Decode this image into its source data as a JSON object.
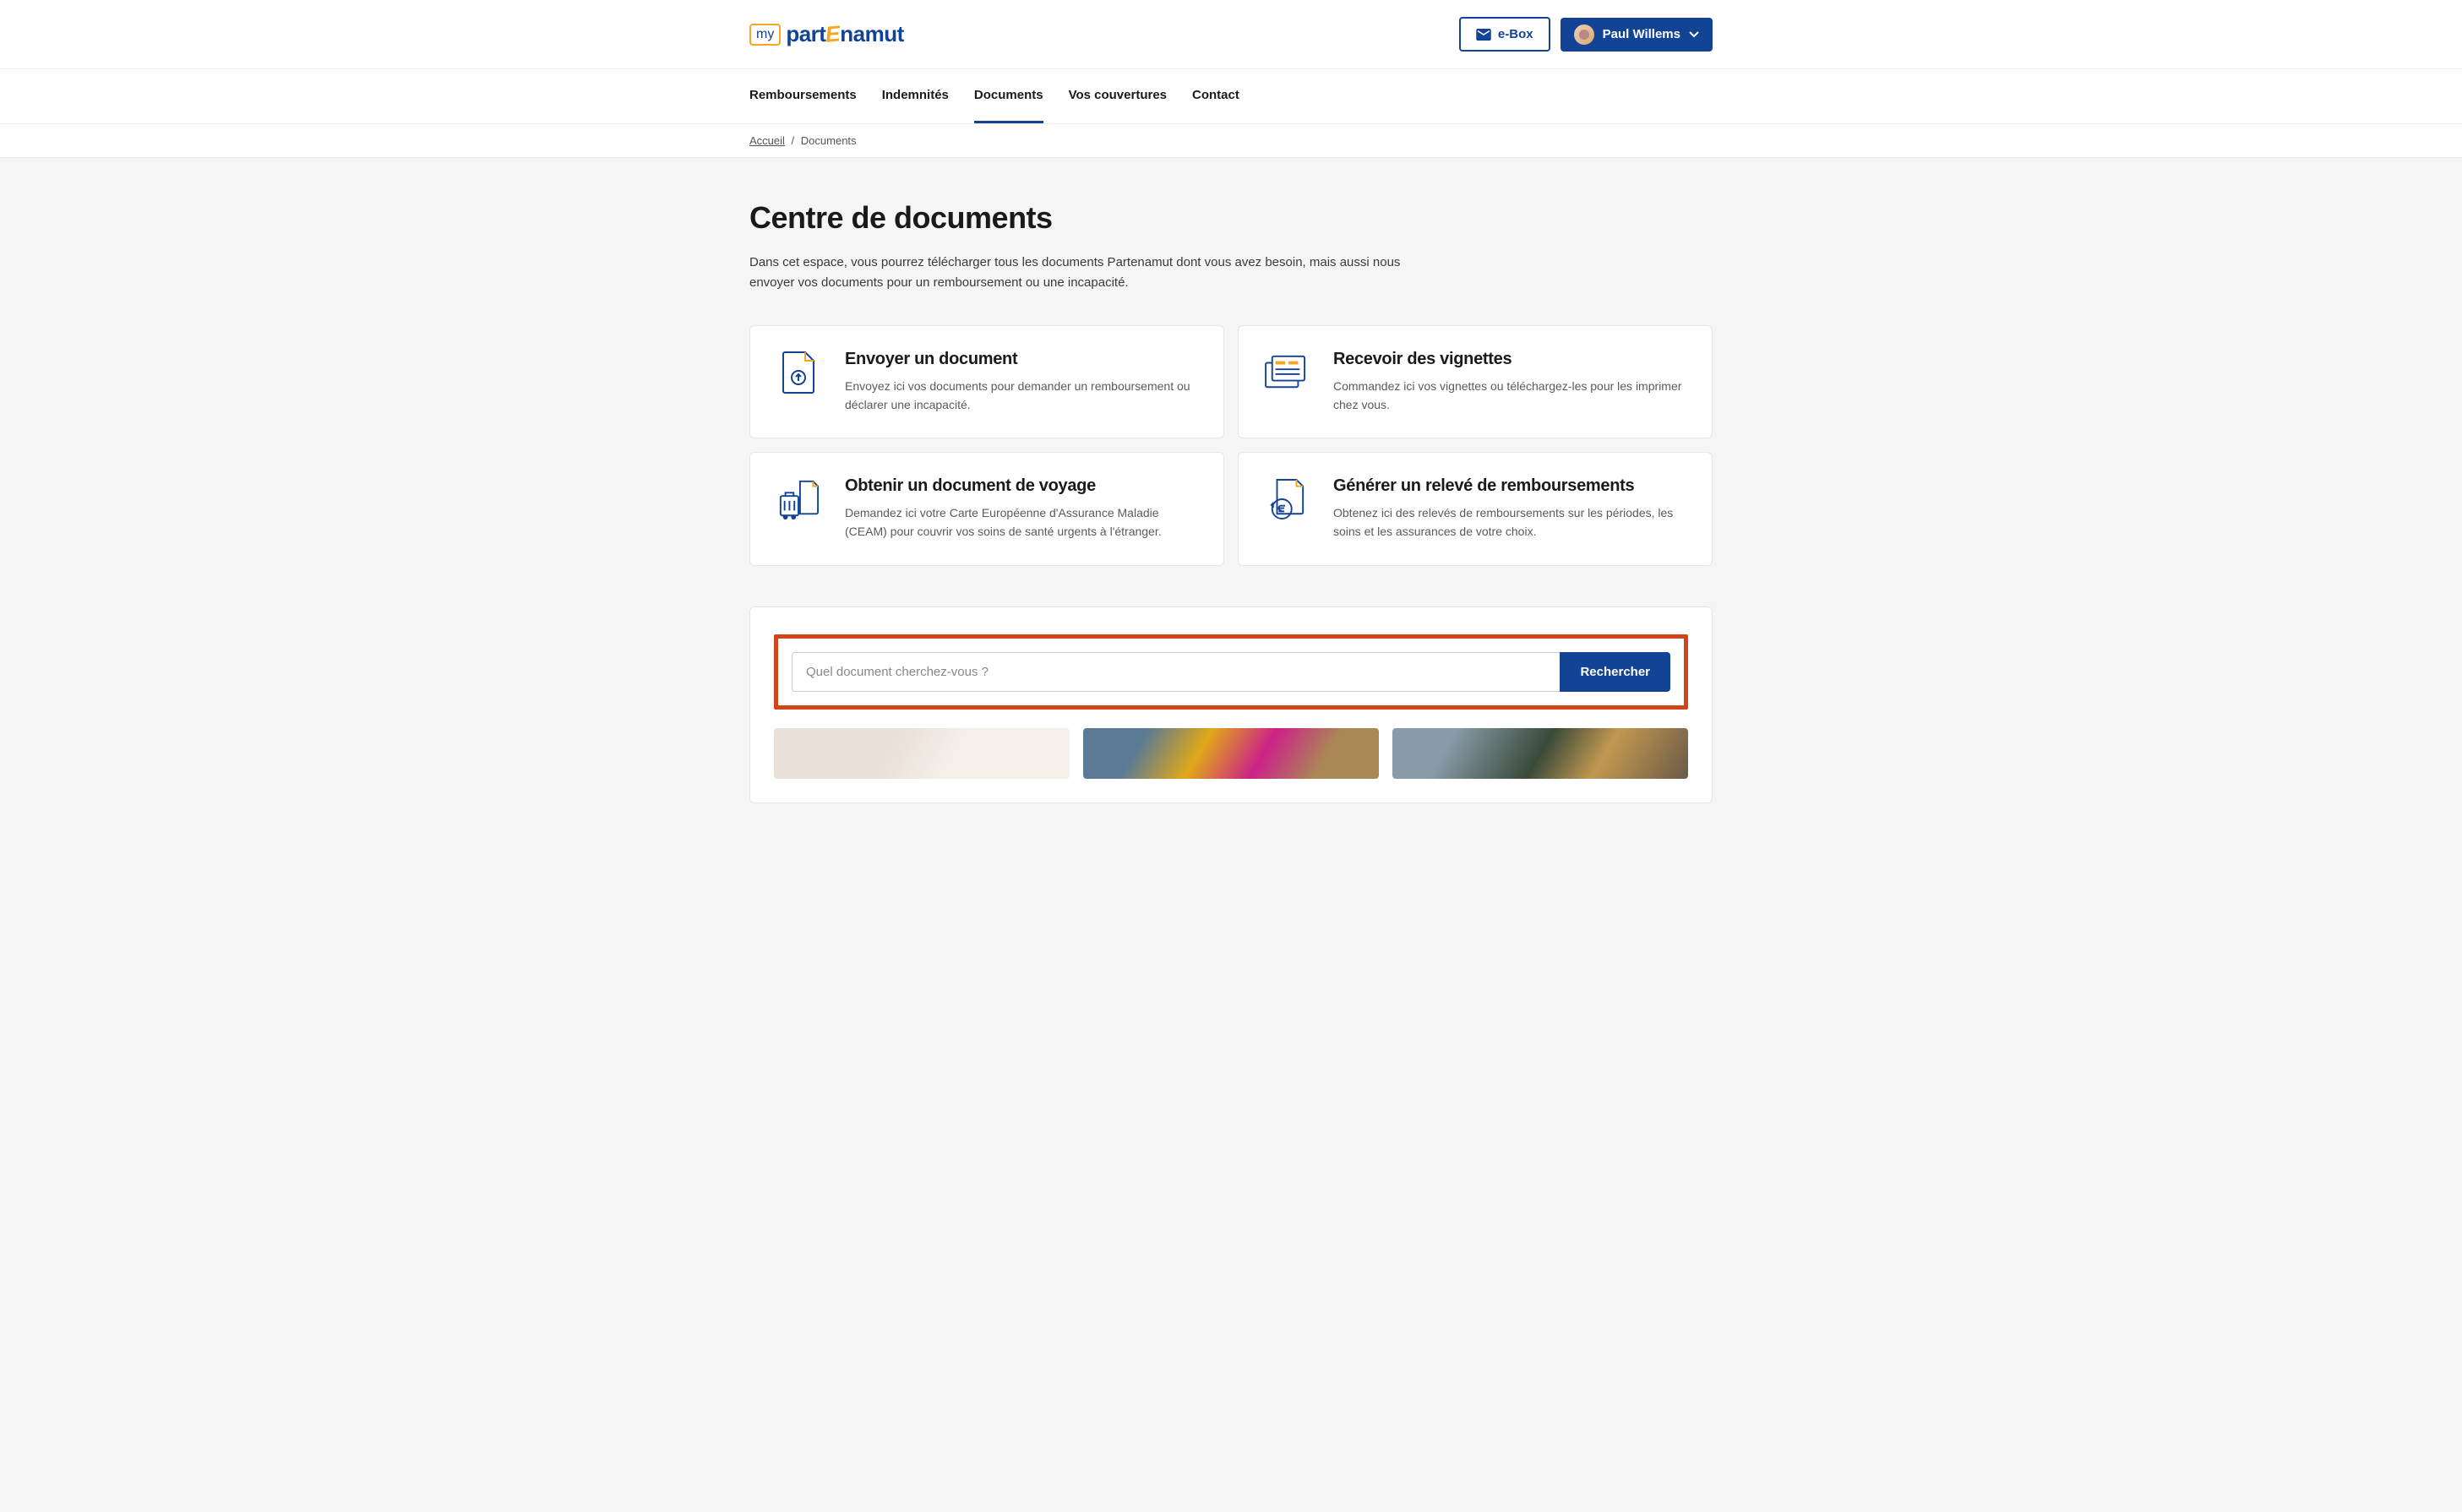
{
  "header": {
    "logo_my": "my",
    "logo_part": "part",
    "logo_e": "E",
    "logo_namut": "namut",
    "ebox_label": "e-Box",
    "user_name": "Paul Willems"
  },
  "nav": {
    "items": [
      {
        "label": "Remboursements",
        "active": false
      },
      {
        "label": "Indemnités",
        "active": false
      },
      {
        "label": "Documents",
        "active": true
      },
      {
        "label": "Vos couvertures",
        "active": false
      },
      {
        "label": "Contact",
        "active": false
      }
    ]
  },
  "breadcrumb": {
    "home": "Accueil",
    "current": "Documents"
  },
  "page": {
    "title": "Centre de documents",
    "description": "Dans cet espace, vous pourrez télécharger tous les documents Partenamut dont vous avez besoin, mais aussi nous envoyer vos documents pour un remboursement ou une incapacité."
  },
  "cards": [
    {
      "title": "Envoyer un document",
      "desc": "Envoyez ici vos documents pour demander un remboursement ou déclarer une incapacité."
    },
    {
      "title": "Recevoir des vignettes",
      "desc": "Commandez ici vos vignettes ou téléchargez-les pour les imprimer chez vous."
    },
    {
      "title": "Obtenir un document de voyage",
      "desc": "Demandez ici votre Carte Européenne d'Assurance Maladie (CEAM) pour couvrir vos soins de santé urgents à l'étranger."
    },
    {
      "title": "Générer un relevé de remboursements",
      "desc": "Obtenez ici des relevés de remboursements sur les périodes, les soins et les assurances de votre choix."
    }
  ],
  "search": {
    "placeholder": "Quel document cherchez-vous ?",
    "button": "Rechercher"
  }
}
